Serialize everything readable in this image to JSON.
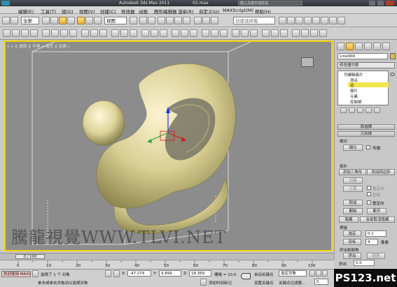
{
  "title": {
    "app": "Autodesk 3ds Max  2011",
    "file": "02.max",
    "search_placeholder": "键入关键字或短语"
  },
  "menu": [
    "编辑(E)",
    "工具(T)",
    "组(G)",
    "视图(V)",
    "创建(C)",
    "修改器",
    "动画",
    "图形编辑器",
    "渲染(R)",
    "自定义(U)",
    "MAXScript(M)",
    "帮助(H)"
  ],
  "toolbar": {
    "select_filter": "全部",
    "ref_coord": "视图",
    "named_selection": "创建选择集"
  },
  "viewport": {
    "label": "[ + ][ 透视 ][ 平滑 + 高光 ][ 边面 ]",
    "watermark": "騰龍視覺WWW.TLVI.NET"
  },
  "command_panel": {
    "object_name": "Line004",
    "modifier_list": "修改器列表",
    "stack": [
      {
        "label": "可编辑面片",
        "selected": false
      },
      {
        "label": "顶点",
        "selected": false
      },
      {
        "label": "边",
        "selected": true
      },
      {
        "label": "面片",
        "selected": false
      },
      {
        "label": "元素",
        "selected": false
      },
      {
        "label": "控制柄",
        "selected": false
      }
    ],
    "soft_selection": "软选择",
    "geometry": "几何体",
    "subdivide_title": "细分",
    "subdivide_btn": "细分",
    "propagate": "传播",
    "topology_title": "拓扑",
    "add_tri": "添加三角形",
    "add_quad": "添加四边形",
    "create": "创建",
    "detach": "分离",
    "reorient": "重定向",
    "copy": "复制",
    "attach": "附加",
    "reorient2": "重定向",
    "delete": "删除",
    "break": "断开",
    "hide": "隐藏",
    "unhide_all": "全部取消隐藏",
    "weld_title": "焊接",
    "selected": "选定",
    "weld_value": "0.1",
    "target": "目标",
    "target_value": "4",
    "pixels": "像素",
    "extrude_title": "挤出和倒角",
    "extrude": "挤出",
    "bevel": "倒角",
    "extrude_value": "0.0"
  },
  "timeline": {
    "frame": "0 / 100",
    "ticks": [
      "0",
      "10",
      "20",
      "30",
      "40",
      "50",
      "60",
      "70",
      "80",
      "90",
      "100"
    ]
  },
  "status": {
    "selection": "选择了 1 个 对象",
    "x_label": "X:",
    "x_value": "-47.274",
    "y_label": "Y:",
    "y_value": "9.899",
    "z_label": "Z:",
    "z_value": "18.369",
    "grid": "栅格 = 10.0",
    "autokey": "自动关键点",
    "selected_object": "选定对象",
    "setkey": "设置关键点",
    "keyfilter": "关键点过滤器...",
    "maxscript": "欢迎使用 MAXScr",
    "prompt": "单击或单击并拖动以选择对象",
    "add_time_tag": "添加时间标记",
    "frame_value": "0"
  },
  "logo": "PS123.net"
}
